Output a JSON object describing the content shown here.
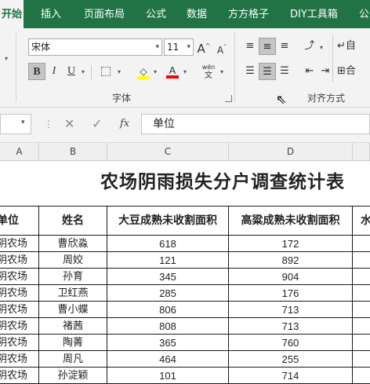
{
  "tabs": [
    "开始",
    "插入",
    "页面布局",
    "公式",
    "数据",
    "方方格子",
    "DIY工具箱",
    "公"
  ],
  "ribbon": {
    "font_name": "宋体",
    "font_size": "11",
    "grow_font": "A",
    "shrink_font": "A",
    "bold": "B",
    "italic": "I",
    "underline": "U",
    "font_color_letter": "A",
    "phonetic": "wén",
    "phonetic_sub": "文",
    "wrap_label": "自",
    "merge_label": "合",
    "font_group": "字体",
    "align_group": "对齐方式",
    "colors": {
      "highlight": "#ffff00",
      "font_color": "#ff0000"
    }
  },
  "formula_bar": {
    "fx": "fx",
    "value": "单位"
  },
  "columns": [
    "A",
    "B",
    "C",
    "D"
  ],
  "sheet": {
    "title": "农场阴雨损失分户调查统计表",
    "headers": [
      "单位",
      "姓名",
      "大豆成熟未收割面积",
      "高粱成熟未收割面积",
      "水"
    ],
    "rows": [
      [
        "阴农场",
        "曹欣淼",
        "618",
        "172"
      ],
      [
        "阴农场",
        "周姣",
        "121",
        "892"
      ],
      [
        "阴农场",
        "孙育",
        "345",
        "904"
      ],
      [
        "阴农场",
        "卫红燕",
        "285",
        "176"
      ],
      [
        "阴农场",
        "曹小蝶",
        "806",
        "713"
      ],
      [
        "阴农场",
        "褚茜",
        "808",
        "713"
      ],
      [
        "阴农场",
        "陶菁",
        "365",
        "760"
      ],
      [
        "阴农场",
        "周凡",
        "464",
        "255"
      ],
      [
        "阴农场",
        "孙淀颖",
        "101",
        "714"
      ]
    ]
  }
}
